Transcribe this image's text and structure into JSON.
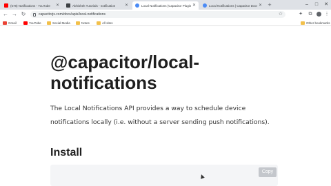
{
  "browser": {
    "tabs": [
      {
        "title": "(678) Notifications - YouTube",
        "favicon_color": "#ff0000",
        "active": false
      },
      {
        "title": "Abhishek Tutorials - notification",
        "favicon_color": "#3c4043",
        "active": false
      },
      {
        "title": "Local Notifications (Capacitor Plugin)",
        "favicon_color": "#4b8bf5",
        "active": true
      },
      {
        "title": "Local Notifications | Capacitor Docs",
        "favicon_color": "#4b8bf5",
        "active": false
      }
    ],
    "new_tab_label": "+",
    "window_controls": {
      "minimize": "–",
      "maximize": "□",
      "close": "✕"
    },
    "url": "capacitorjs.com/docs/apis/local-notifications",
    "bookmarks": [
      {
        "label": "Gmail",
        "icon": "gmail-icon",
        "color": "#ea4335"
      },
      {
        "label": "YouTube",
        "icon": "youtube-icon",
        "color": "#ff0000"
      },
      {
        "label": "Social Media",
        "icon": "folder-icon",
        "color": "#f2c04a"
      },
      {
        "label": "Notes",
        "icon": "folder-icon",
        "color": "#f2c04a"
      },
      {
        "label": "All sites",
        "icon": "folder-icon",
        "color": "#f2c04a"
      }
    ],
    "other_bookmarks": "Other bookmarks"
  },
  "page": {
    "title": "@capacitor/local-notifications",
    "description": "The Local Notifications API provides a way to schedule device notifications locally (i.e. without a server sending push notifications).",
    "install_heading": "Install",
    "copy_label": "Copy"
  }
}
